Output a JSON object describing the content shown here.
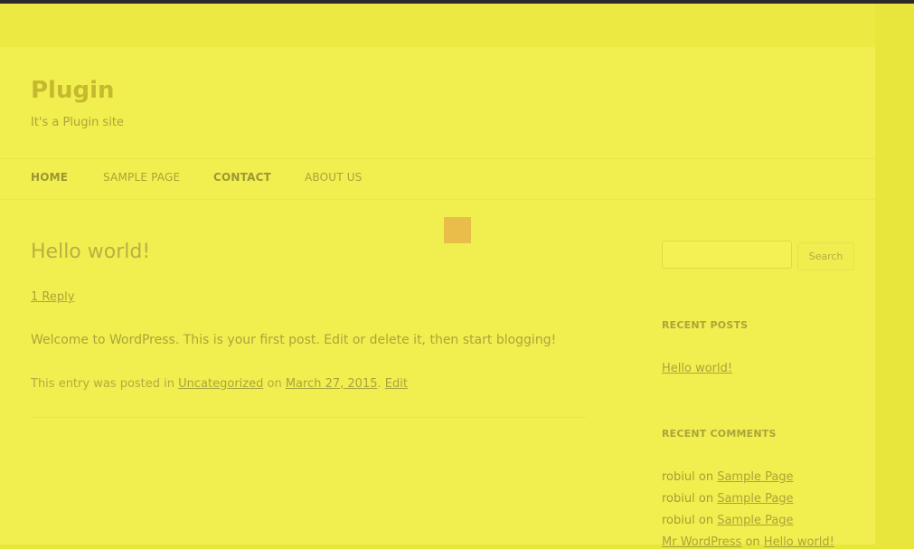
{
  "site": {
    "title": "Plugin",
    "description": "It's a Plugin site"
  },
  "nav": {
    "items": [
      {
        "label": "HOME"
      },
      {
        "label": "SAMPLE PAGE"
      },
      {
        "label": "CONTACT"
      },
      {
        "label": "ABOUT US"
      }
    ]
  },
  "post": {
    "title": "Hello world!",
    "reply_link": "1 Reply",
    "content": "Welcome to WordPress. This is your first post. Edit or delete it, then start blogging!",
    "meta_prefix": "This entry was posted in ",
    "category": "Uncategorized",
    "meta_on": " on ",
    "date": "March 27, 2015",
    "meta_sep": ". ",
    "edit": "Edit"
  },
  "sidebar": {
    "search": {
      "value": "",
      "button_label": "Search"
    },
    "recent_posts": {
      "title": "RECENT POSTS",
      "items": [
        {
          "label": "Hello world!"
        }
      ]
    },
    "recent_comments": {
      "title": "RECENT COMMENTS",
      "items": [
        {
          "author": "robiul",
          "on": " on ",
          "post": "Sample Page"
        },
        {
          "author": "robiul",
          "on": " on ",
          "post": "Sample Page"
        },
        {
          "author": "robiul",
          "on": " on ",
          "post": "Sample Page"
        },
        {
          "author": "Mr WordPress",
          "on": " on ",
          "post": "Hello world!"
        }
      ]
    }
  },
  "colors": {
    "page_background": "#f1ef4f",
    "outer_background": "#e8e63a",
    "text": "#a9a53a",
    "loading_indicator": "#e9bd4a"
  }
}
